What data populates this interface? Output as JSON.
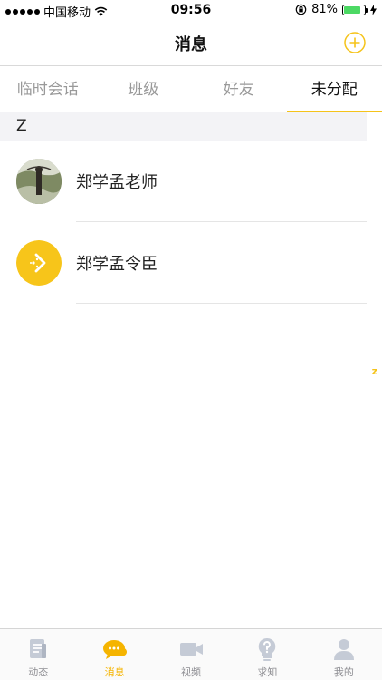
{
  "status_bar": {
    "carrier": "中国移动",
    "time": "09:56",
    "battery": "81%",
    "battery_level": 0.81
  },
  "nav": {
    "title": "消息",
    "add_icon": "plus-circle-icon"
  },
  "tabs": [
    {
      "label": "临时会话"
    },
    {
      "label": "班级"
    },
    {
      "label": "好友"
    },
    {
      "label": "未分配",
      "active": true
    }
  ],
  "section": {
    "letter": "Z"
  },
  "contacts": [
    {
      "name": "郑学孟老师",
      "avatar": "photo-avatar"
    },
    {
      "name": "郑学孟令臣",
      "avatar": "yellow-arrow-avatar"
    }
  ],
  "index": {
    "letter": "z"
  },
  "tab_bar": [
    {
      "label": "动态",
      "icon": "document-icon"
    },
    {
      "label": "消息",
      "icon": "chat-bubble-icon",
      "active": true
    },
    {
      "label": "视频",
      "icon": "video-camera-icon"
    },
    {
      "label": "求知",
      "icon": "question-lightbulb-icon"
    },
    {
      "label": "我的",
      "icon": "person-icon"
    }
  ],
  "colors": {
    "accent": "#f5c31a",
    "active_tab_label": "#f5b400",
    "inactive_icon": "#c5cbd6"
  }
}
